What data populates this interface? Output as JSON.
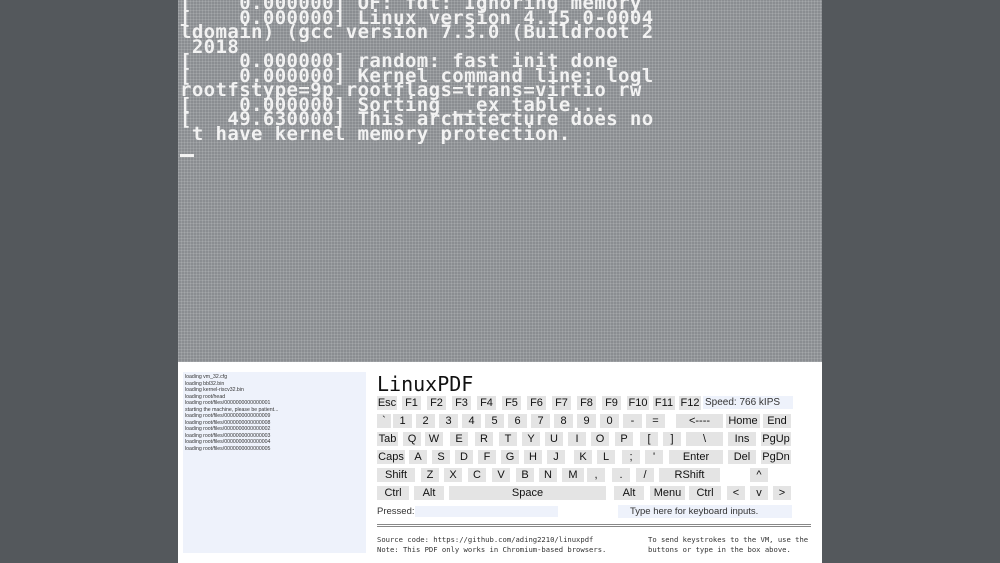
{
  "terminal": {
    "lines": [
      "[    0.000000] OF: fdt: Ignoring memory",
      "[    0.000000] Linux version 4.15.0-0004",
      "ldomain) (gcc version 7.3.0 (Buildroot 2",
      " 2018",
      "[    0.000000] random: fast init done",
      "[    0.000000] Kernel command line: logl",
      "rootfstype=9p rootflags=trans=virtio rw",
      "[    0.000000] Sorting __ex_table...",
      "[   49.630000] This architecture does no",
      " t have kernel memory protection."
    ]
  },
  "log": [
    "loading vm_32.cfg",
    "loading bbl32.bin",
    "loading kernel-riscv32.bin",
    "loading root/head",
    "loading root/files/0000000000000001",
    "starting the machine, please be patient...",
    "loading root/files/0000000000000009",
    "loading root/files/0000000000000008",
    "loading root/files/0000000000000002",
    "loading root/files/0000000000000003",
    "loading root/files/0000000000000004",
    "loading root/files/0000000000000005"
  ],
  "app_title": "LinuxPDF",
  "speed": "Speed: 766 kIPS",
  "keys": {
    "esc": "Esc",
    "f1": "F1",
    "f2": "F2",
    "f3": "F3",
    "f4": "F4",
    "f5": "F5",
    "f6": "F6",
    "f7": "F7",
    "f8": "F8",
    "f9": "F9",
    "f10": "F10",
    "f11": "F11",
    "f12": "F12",
    "backtick": "`",
    "d1": "1",
    "d2": "2",
    "d3": "3",
    "d4": "4",
    "d5": "5",
    "d6": "6",
    "d7": "7",
    "d8": "8",
    "d9": "9",
    "d0": "0",
    "minus": "-",
    "equals": "=",
    "backspace": "<----",
    "home": "Home",
    "end": "End",
    "tab": "Tab",
    "q": "Q",
    "w": "W",
    "e": "E",
    "r": "R",
    "t": "T",
    "y": "Y",
    "u": "U",
    "i": "I",
    "o": "O",
    "p": "P",
    "lbracket": "[",
    "rbracket": "]",
    "backslash": "\\",
    "ins": "Ins",
    "pgup": "PgUp",
    "caps": "Caps",
    "a": "A",
    "s": "S",
    "d": "D",
    "f": "F",
    "g": "G",
    "h": "H",
    "j": "J",
    "k": "K",
    "l": "L",
    "semicolon": ";",
    "quote": "'",
    "enter": "Enter",
    "del": "Del",
    "pgdn": "PgDn",
    "shift": "Shift",
    "z": "Z",
    "x": "X",
    "c": "C",
    "v": "V",
    "b": "B",
    "n": "N",
    "m": "M",
    "comma": ",",
    "period": ".",
    "slash": "/",
    "rshift": "RShift",
    "up": "^",
    "ctrl": "Ctrl",
    "alt": "Alt",
    "space": "Space",
    "ralt": "Alt",
    "menu": "Menu",
    "rctrl": "Ctrl",
    "left": "<",
    "down": "v",
    "right": ">"
  },
  "pressed_label": "Pressed:",
  "input_placeholder": "Type here for keyboard inputs.",
  "footer": {
    "source": "Source code: https://github.com/ading2210/linuxpdf",
    "note": "Note: This PDF only works in Chromium-based browsers.",
    "tip1": "To send keystrokes to the VM, use the",
    "tip2": "buttons or type in the box above."
  }
}
